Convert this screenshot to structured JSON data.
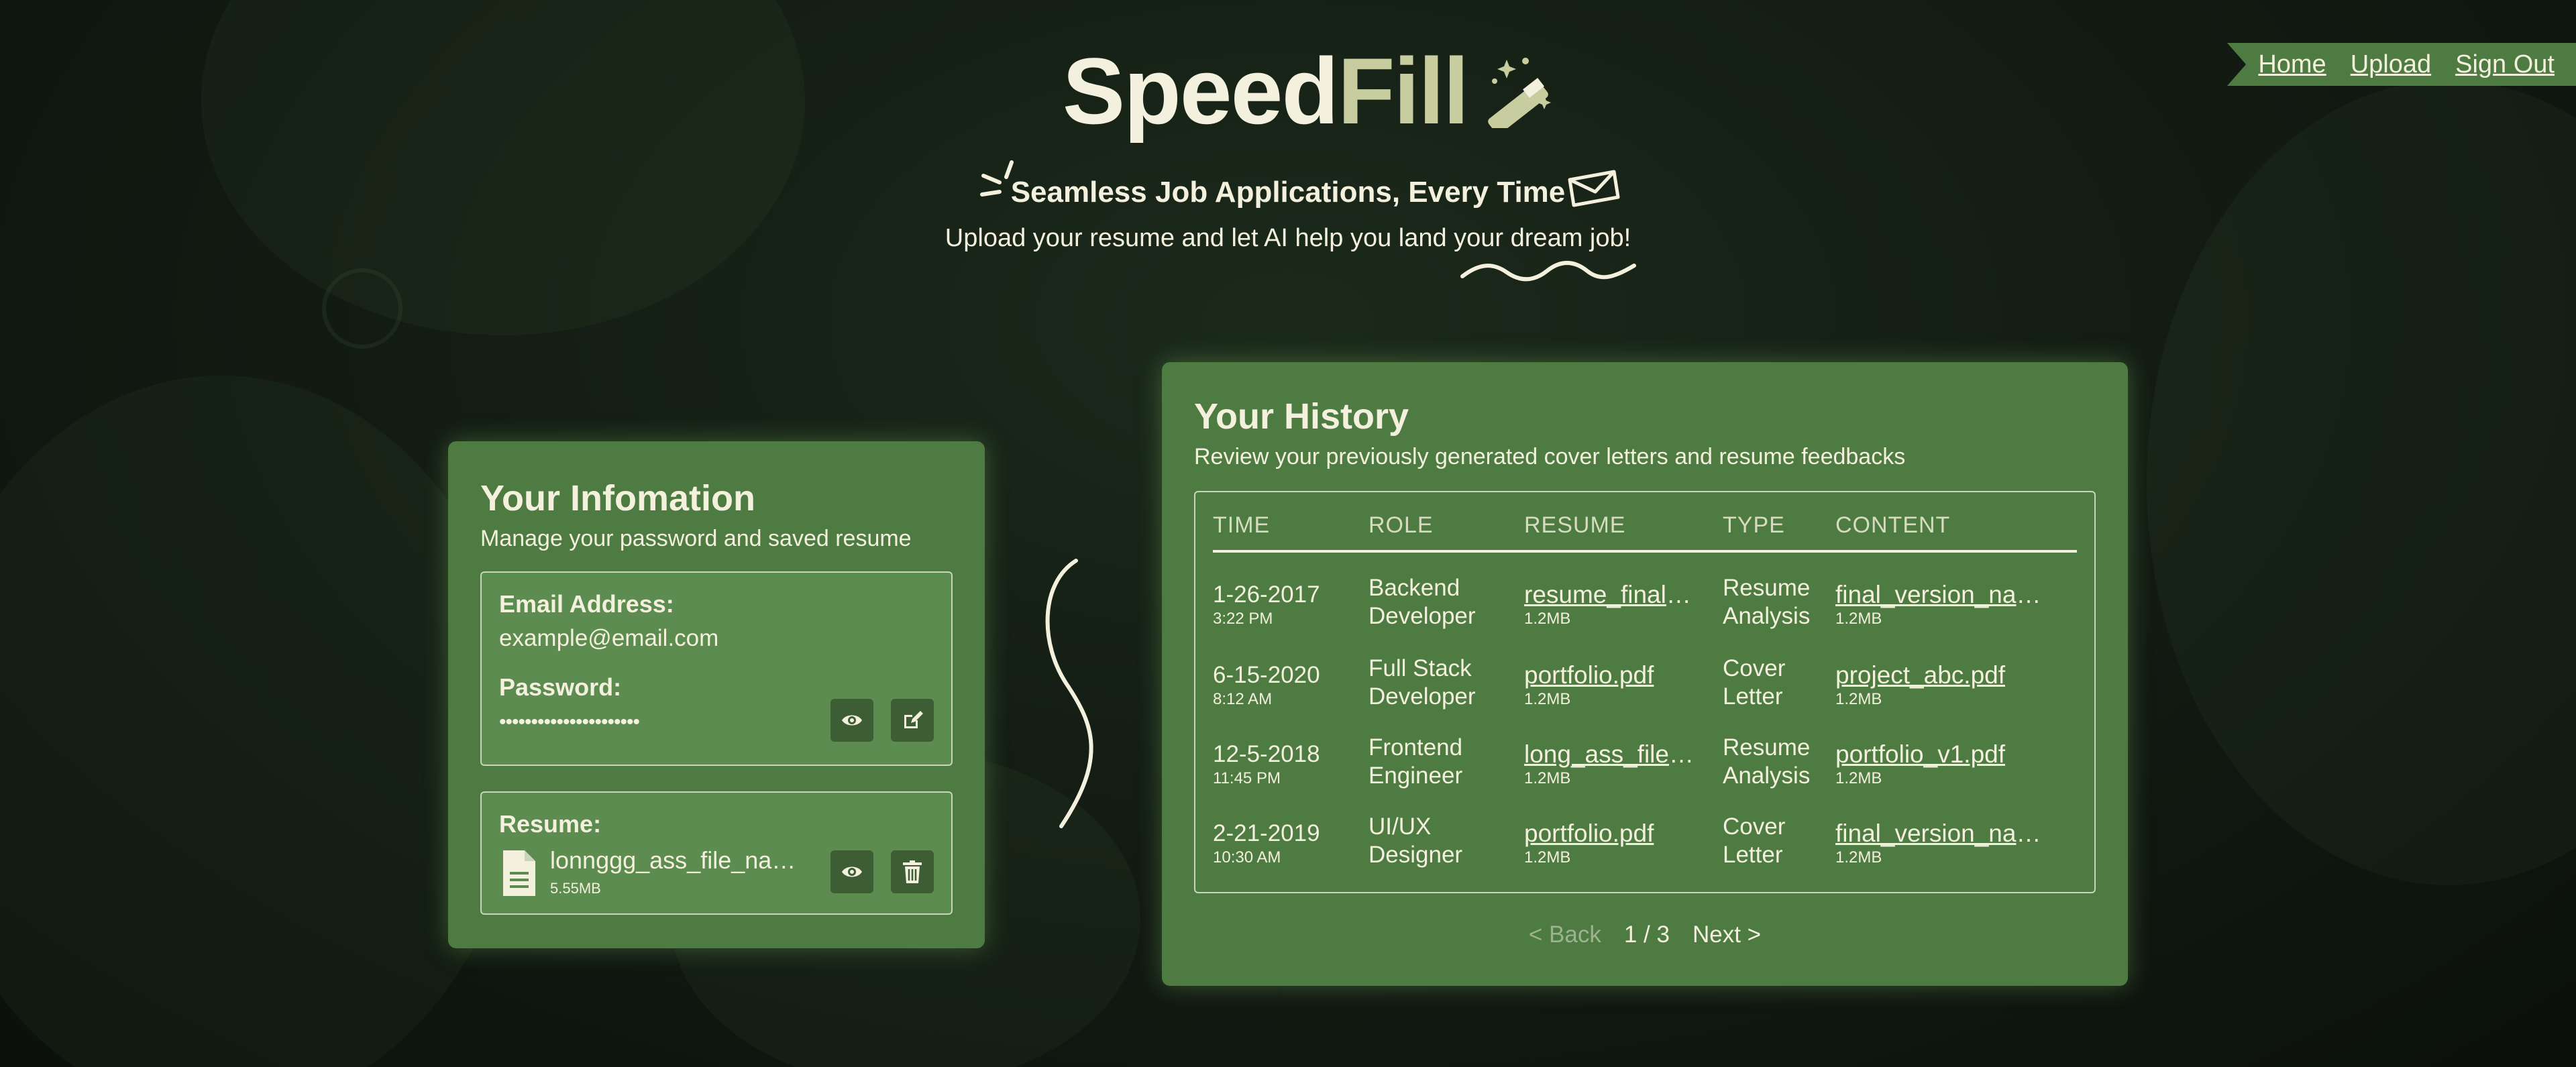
{
  "nav": {
    "home": "Home",
    "upload": "Upload",
    "sign_out": "Sign Out"
  },
  "header": {
    "brand_part1": "Speed",
    "brand_part2": "Fill",
    "tagline": "Seamless Job Applications, Every Time",
    "subtitle": "Upload your resume and let AI help you land your dream job!"
  },
  "info_card": {
    "title": "Your Infomation",
    "description": "Manage your password and saved resume",
    "email_label": "Email Address:",
    "email_value": "example@email.com",
    "password_label": "Password:",
    "password_value": "••••••••••••••••••••••",
    "resume_label": "Resume:",
    "resume_file_name": "lonnggg_ass_file_name.pdf",
    "resume_file_size": "5.55MB"
  },
  "history_card": {
    "title": "Your History",
    "description": "Review your previously generated cover letters and resume feedbacks",
    "columns": [
      "TIME",
      "ROLE",
      "RESUME",
      "TYPE",
      "CONTENT"
    ],
    "rows": [
      {
        "date": "1-26-2017",
        "time": "3:22 PM",
        "role_line1": "Backend",
        "role_line2": "Developer",
        "resume": "resume_final_version.pdf",
        "resume_size": "1.2MB",
        "type_line1": "Resume",
        "type_line2": "Analysis",
        "content": "final_version_name.pdf",
        "content_size": "1.2MB"
      },
      {
        "date": "6-15-2020",
        "time": "8:12 AM",
        "role_line1": "Full Stack",
        "role_line2": "Developer",
        "resume": "portfolio.pdf",
        "resume_size": "1.2MB",
        "type_line1": "Cover",
        "type_line2": "Letter",
        "content": "project_abc.pdf",
        "content_size": "1.2MB"
      },
      {
        "date": "12-5-2018",
        "time": "11:45 PM",
        "role_line1": "Frontend",
        "role_line2": "Engineer",
        "resume": "long_ass_file_name.pdf",
        "resume_size": "1.2MB",
        "type_line1": "Resume",
        "type_line2": "Analysis",
        "content": "portfolio_v1.pdf",
        "content_size": "1.2MB"
      },
      {
        "date": "2-21-2019",
        "time": "10:30 AM",
        "role_line1": "UI/UX",
        "role_line2": "Designer",
        "resume": "portfolio.pdf",
        "resume_size": "1.2MB",
        "type_line1": "Cover",
        "type_line2": "Letter",
        "content": "final_version_name.pdf",
        "content_size": "1.2MB"
      }
    ],
    "pager": {
      "back": "< Back",
      "page": "1 / 3",
      "next": "Next >"
    }
  },
  "icons": [
    "magic-wand-icon",
    "sparkle-lines-icon",
    "envelope-icon",
    "squiggle-underline-icon",
    "eye-icon",
    "edit-icon",
    "document-icon",
    "trash-icon",
    "curved-line-icon"
  ],
  "colors": {
    "card_green": "#4e7b42",
    "inner_green": "#5c8c50",
    "text_cream": "#f3f0dd",
    "accent_khaki": "#c8cda0",
    "background": "#101610"
  }
}
